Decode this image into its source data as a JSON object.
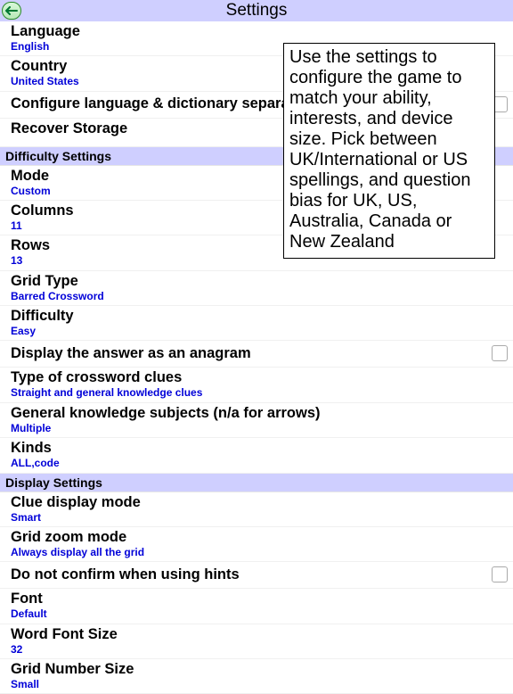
{
  "header": {
    "title": "Settings"
  },
  "tooltip": "Use the settings to configure the game to match your ability, interests, and device size. Pick between UK/International or US spellings, and question bias for UK, US, Australia, Canada or New Zealand",
  "general": {
    "language": {
      "label": "Language",
      "value": "English"
    },
    "country": {
      "label": "Country",
      "value": "United States"
    },
    "configSeparate": {
      "label": "Configure language & dictionary separately"
    },
    "recover": {
      "label": "Recover Storage"
    }
  },
  "sections": {
    "difficulty": "Difficulty Settings",
    "display": "Display Settings"
  },
  "difficulty": {
    "mode": {
      "label": "Mode",
      "value": "Custom"
    },
    "columns": {
      "label": "Columns",
      "value": "11"
    },
    "rows": {
      "label": "Rows",
      "value": "13"
    },
    "gridType": {
      "label": "Grid Type",
      "value": "Barred Crossword"
    },
    "diff": {
      "label": "Difficulty",
      "value": "Easy"
    },
    "anagram": {
      "label": "Display the answer as an anagram"
    },
    "clueType": {
      "label": "Type of crossword clues",
      "value": "Straight and general knowledge clues"
    },
    "gkSubjects": {
      "label": "General knowledge subjects (n/a for arrows)",
      "value": "Multiple"
    },
    "kinds": {
      "label": "Kinds",
      "value": "ALL,code"
    }
  },
  "display": {
    "clueMode": {
      "label": "Clue display mode",
      "value": "Smart"
    },
    "zoomMode": {
      "label": "Grid zoom mode",
      "value": "Always display all the grid"
    },
    "noConfirm": {
      "label": "Do not confirm when using hints"
    },
    "font": {
      "label": "Font",
      "value": "Default"
    },
    "wordFont": {
      "label": "Word Font Size",
      "value": "32"
    },
    "gridNum": {
      "label": "Grid Number Size",
      "value": "Small"
    }
  }
}
